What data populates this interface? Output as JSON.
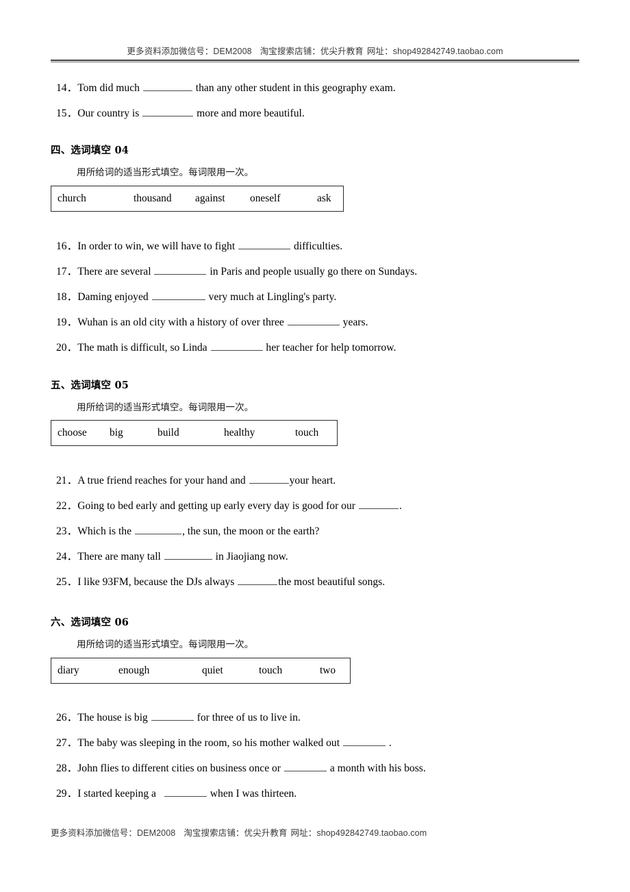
{
  "watermark": {
    "prefix": "更多资料添加微信号：",
    "wechat_id": "DEM2008",
    "shop_label": "淘宝搜索店铺：",
    "shop_name": "优尖升教育",
    "url_label": "网址：",
    "url": "shop492842749.taobao.com"
  },
  "top_questions": [
    {
      "num": "14．",
      "before": "Tom did much",
      "after": "than any other student in this geography exam."
    },
    {
      "num": "15．",
      "before": "Our country is",
      "after": "more and more beautiful."
    }
  ],
  "sections": [
    {
      "heading_cn": "四、选词填空",
      "heading_num": "04",
      "instruction": "用所给词的适当形式填空。每词限用一次。",
      "words": [
        "church",
        "thousand",
        "against",
        "oneself",
        "ask"
      ],
      "questions": [
        {
          "num": "16．",
          "before": "In order to win, we will have to fight",
          "after": "difficulties."
        },
        {
          "num": "17．",
          "before": "There are several",
          "after": "in Paris and people usually go there on Sundays."
        },
        {
          "num": "18．",
          "before": "Daming enjoyed",
          "after": "very much at Lingling's party."
        },
        {
          "num": "19．",
          "before": "Wuhan is an old city with a history of over three",
          "after": "years."
        },
        {
          "num": "20．",
          "before": "The math is difficult, so Linda",
          "after": "her teacher for help tomorrow."
        }
      ]
    },
    {
      "heading_cn": "五、选词填空",
      "heading_num": "05",
      "instruction": "用所给词的适当形式填空。每词限用一次。",
      "words": [
        "choose",
        "big",
        "build",
        "healthy",
        "touch"
      ],
      "questions": [
        {
          "num": "21．",
          "before": "A true friend reaches for your hand and",
          "after": "your heart."
        },
        {
          "num": "22．",
          "before": "Going to bed early and getting up early every day is good for our",
          "after": "."
        },
        {
          "num": "23．",
          "before": "Which is the",
          "after": ", the sun, the moon or the earth?"
        },
        {
          "num": "24．",
          "before": "There are many tall",
          "after": "in Jiaojiang now."
        },
        {
          "num": "25．",
          "before": "I like 93FM, because the DJs always",
          "after": "the most beautiful songs."
        }
      ]
    },
    {
      "heading_cn": "六、选词填空",
      "heading_num": "06",
      "instruction": "用所给词的适当形式填空。每词限用一次。",
      "words": [
        "diary",
        "enough",
        "quiet",
        "touch",
        "two"
      ],
      "questions": [
        {
          "num": "26．",
          "before": "The house is big",
          "after": "for three of us to live in."
        },
        {
          "num": "27．",
          "before": "The baby was sleeping in the room, so his mother walked out",
          "after": "."
        },
        {
          "num": "28．",
          "before": "John flies to different cities on business once or",
          "after": "a month with his boss."
        },
        {
          "num": "29．",
          "before": "I started keeping a",
          "after": "when I was thirteen."
        }
      ]
    }
  ]
}
